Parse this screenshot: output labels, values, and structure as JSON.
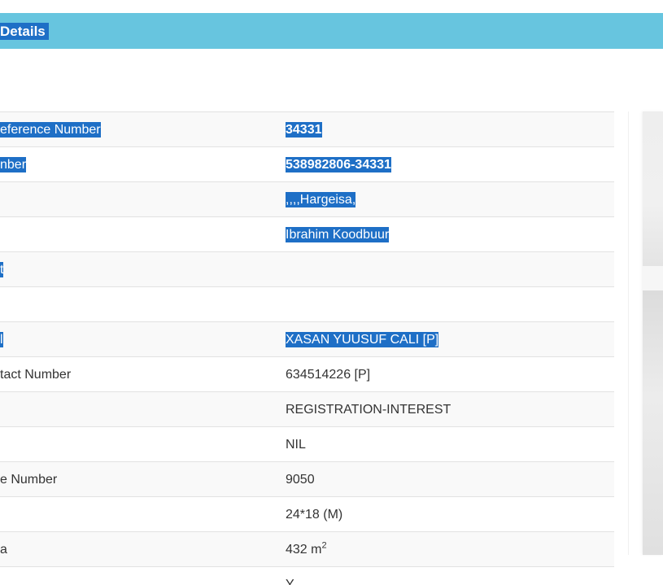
{
  "header": {
    "title": "Details"
  },
  "rows": [
    {
      "label": "eference Number",
      "value": "34331",
      "label_selected": true,
      "value_selected": true,
      "value_bold": true
    },
    {
      "label": "nber",
      "value": "538982806-34331",
      "label_selected": true,
      "value_selected": true,
      "value_bold": true
    },
    {
      "label": "",
      "value": ",,,,Hargeisa,",
      "label_selected": false,
      "value_selected": true,
      "value_bold": false
    },
    {
      "label": "",
      "value": "Ibrahim Koodbuur",
      "label_selected": false,
      "value_selected": true,
      "value_bold": false
    },
    {
      "label": "t",
      "value": "",
      "label_selected": true,
      "value_selected": false,
      "value_bold": false
    },
    {
      "label": "",
      "value": "",
      "label_selected": false,
      "value_selected": false,
      "value_bold": false
    },
    {
      "label": "l",
      "value": "XASAN YUUSUF CALI [P]",
      "label_selected": true,
      "value_selected": true,
      "value_bold": false
    },
    {
      "label": "tact Number",
      "value": "634514226 [P]",
      "label_selected": false,
      "value_selected": false,
      "value_bold": false
    },
    {
      "label": "",
      "value": "REGISTRATION-INTEREST",
      "label_selected": false,
      "value_selected": false,
      "value_bold": false
    },
    {
      "label": "",
      "value": "NIL",
      "label_selected": false,
      "value_selected": false,
      "value_bold": false
    },
    {
      "label": "e Number",
      "value": "9050",
      "label_selected": false,
      "value_selected": false,
      "value_bold": false
    },
    {
      "label": "",
      "value": "24*18 (M)",
      "label_selected": false,
      "value_selected": false,
      "value_bold": false
    },
    {
      "label": "a",
      "value": "432 m",
      "value_sup": "2",
      "label_selected": false,
      "value_selected": false,
      "value_bold": false
    },
    {
      "label": "",
      "value": "Y",
      "label_selected": false,
      "value_selected": false,
      "value_bold": false
    }
  ],
  "colors": {
    "header_bg": "#67c5df",
    "selection_bg": "#1e6fc6",
    "text": "#333333"
  }
}
